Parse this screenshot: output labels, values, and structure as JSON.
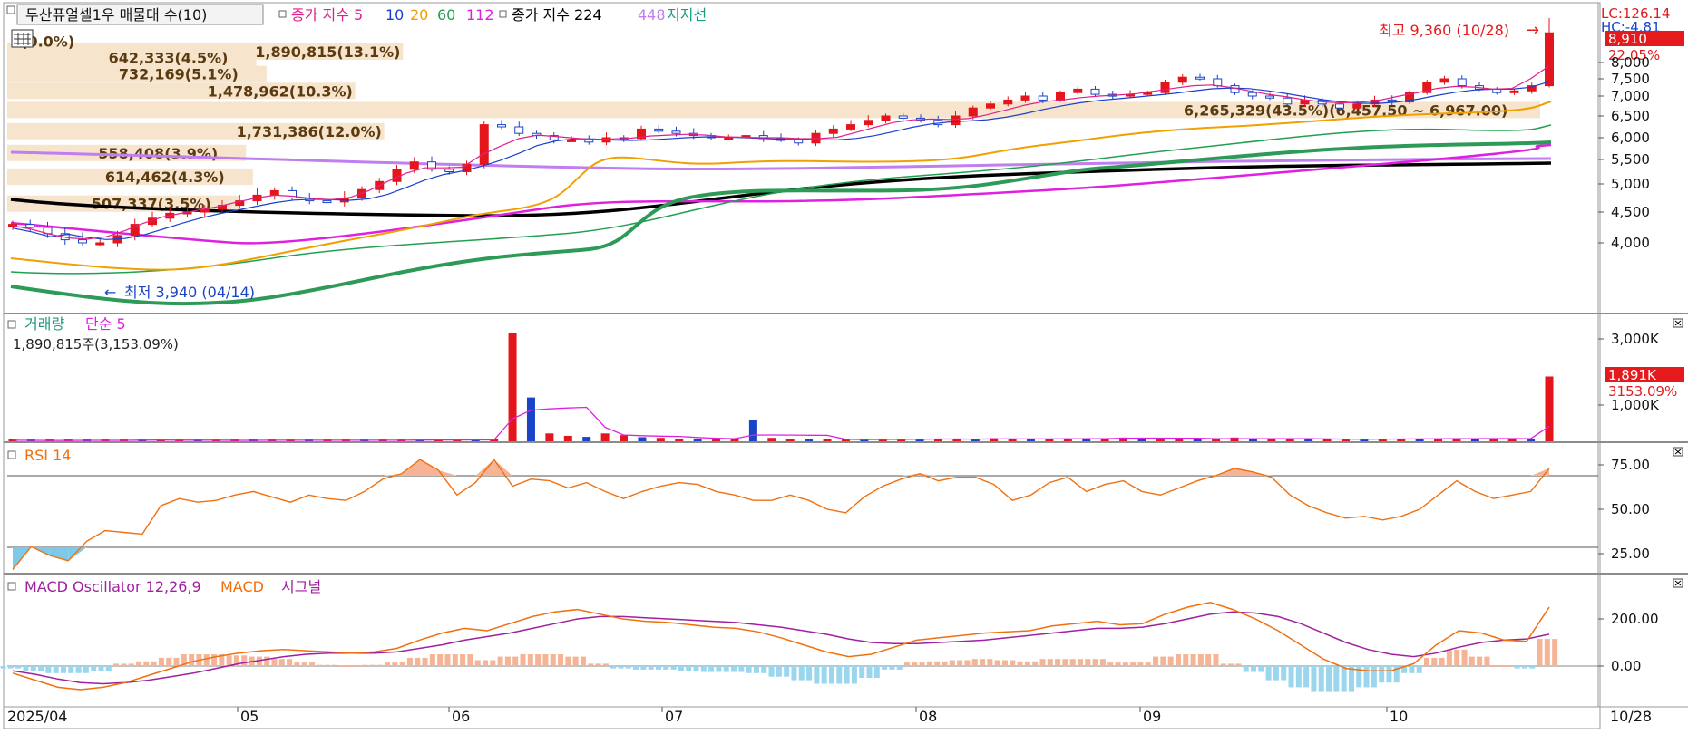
{
  "window": {
    "title": "두산퓨얼셀1우 매물대 수(10)"
  },
  "legends": {
    "price": [
      {
        "text": "종가 지수 5",
        "color": "#e0208a"
      },
      {
        "text": "10",
        "color": "#1a3fd0"
      },
      {
        "text": "20",
        "color": "#f0a000"
      },
      {
        "text": "60",
        "color": "#21a050"
      },
      {
        "text": "112",
        "color": "#e020e0"
      },
      {
        "text": "종가 지수 224",
        "color": "#000000"
      },
      {
        "text": "448",
        "color": "#c07ef0"
      },
      {
        "text": "지지선",
        "color": "#1a9a80"
      }
    ],
    "volume": [
      {
        "text": "거래량",
        "color": "#1a9a80"
      },
      {
        "text": "단순 5",
        "color": "#e020e0"
      }
    ],
    "rsi": [
      {
        "text": "RSI 14",
        "color": "#f07010"
      }
    ],
    "macd": [
      {
        "text": "MACD Oscillator 12,26,9",
        "color": "#a020a0"
      },
      {
        "text": "MACD",
        "color": "#f07010"
      },
      {
        "text": "시그널",
        "color": "#a020a0"
      }
    ]
  },
  "volume_profile": [
    {
      "label": "1,890,815(13.1%)",
      "pct": 13.1,
      "price": 9150
    },
    {
      "label": "0(0.0%)",
      "pct": 0.0,
      "price": 8650
    },
    {
      "label": "642,333(4.5%)",
      "pct": 4.5,
      "price": 8150
    },
    {
      "label": "732,169(5.1%)",
      "pct": 5.1,
      "price": 7650
    },
    {
      "label": "1,478,962(10.3%)",
      "pct": 10.3,
      "price": 7150
    },
    {
      "label": "6,265,329(43.5%)(6,457.50 ~ 6,967.00)",
      "pct": 43.5,
      "price": 6650
    },
    {
      "label": "1,731,386(12.0%)",
      "pct": 12.0,
      "price": 6150
    },
    {
      "label": "558,408(3.9%)",
      "pct": 3.9,
      "price": 5650
    },
    {
      "label": "614,462(4.3%)",
      "pct": 4.3,
      "price": 5150
    },
    {
      "label": "507,337(3.5%)",
      "pct": 3.5,
      "price": 4650
    }
  ],
  "annotations": {
    "high": "최고 9,360 (10/28)",
    "high_arrow": "→",
    "low": "최저 3,940 (04/14)",
    "low_arrow": "←",
    "volume_info": "1,890,815주(3,153.09%)"
  },
  "right_axis": {
    "lc": "LC:126.14",
    "hc": "HC:-4.81",
    "price_ticks": [
      "8,000",
      "7,500",
      "7,000",
      "6,500",
      "6,000",
      "5,500",
      "5,000",
      "4,500",
      "4,000"
    ],
    "volume_ticks": [
      "3,000K",
      "1,000K"
    ],
    "rsi_ticks": [
      "75.00",
      "50.00",
      "25.00"
    ],
    "macd_ticks": [
      "200.00",
      "0.00"
    ]
  },
  "current": {
    "price": "8,910",
    "change": "22.05%",
    "volume": "1,891K",
    "volume_pct": "3153.09%"
  },
  "x_axis": [
    "2025/04",
    "05",
    "06",
    "07",
    "08",
    "09",
    "10"
  ],
  "x_right_label": "10/28",
  "colors": {
    "up": "#e4151b",
    "down": "#1a44c8",
    "profile": "#f6e4cc",
    "rsi": "#f07010",
    "macd": "#f07010",
    "signal": "#a020a0",
    "osc_up": "#f5b496",
    "osc_down": "#9ad6ee"
  },
  "chart_data": [
    {
      "type": "candlestick",
      "title": "두산퓨얼셀1우",
      "x_range": [
        "2025/04",
        "10/28"
      ],
      "ylim": [
        3800,
        9400
      ],
      "series": [
        {
          "name": "종가",
          "values": [
            4300,
            4250,
            4150,
            4050,
            4000,
            4000,
            4120,
            4300,
            4400,
            4480,
            4500,
            4550,
            4620,
            4700,
            4800,
            4880,
            4750,
            4700,
            4680,
            4750,
            4900,
            5050,
            5300,
            5450,
            5300,
            5250,
            5400,
            6300,
            6250,
            6100,
            6050,
            5950,
            5950,
            5900,
            6000,
            5980,
            6200,
            6150,
            6100,
            6050,
            6000,
            6000,
            6050,
            5980,
            5950,
            5880,
            6100,
            6200,
            6300,
            6400,
            6500,
            6450,
            6400,
            6300,
            6500,
            6700,
            6800,
            6900,
            7000,
            6900,
            7100,
            7200,
            7050,
            7000,
            7050,
            7100,
            7400,
            7550,
            7500,
            7300,
            7100,
            7000,
            6950,
            6800,
            6900,
            6800,
            6700,
            6800,
            6900,
            6850,
            7100,
            7400,
            7500,
            7300,
            7200,
            7100,
            7150,
            7300,
            8910
          ]
        },
        {
          "name": "5",
          "values": [
            4280,
            4220,
            4140,
            4080,
            4060,
            4100,
            4200,
            4320,
            4420,
            4480,
            4540,
            4600,
            4680,
            4750,
            4800,
            4780,
            4740,
            4720,
            4760,
            4880,
            5050,
            5220,
            5330,
            5330,
            5340,
            5600,
            5800,
            5980,
            6060,
            6030,
            5990,
            5960,
            5970,
            5990,
            6040,
            6060,
            6080,
            6060,
            6020,
            6010,
            6000,
            6000,
            5980,
            5980,
            6010,
            6120,
            6240,
            6350,
            6410,
            6430,
            6420,
            6440,
            6530,
            6650,
            6770,
            6860,
            6900,
            6960,
            7000,
            7030,
            7070,
            7150,
            7230,
            7300,
            7320,
            7250,
            7150,
            7050,
            6980,
            6900,
            6850,
            6830,
            6850,
            6900,
            7000,
            7100,
            7220,
            7280,
            7260,
            7200,
            7220,
            7500,
            7900
          ]
        }
      ],
      "volume_profile_pct": [
        13.1,
        0.0,
        4.5,
        5.1,
        10.3,
        43.5,
        12.0,
        3.9,
        4.3,
        3.5
      ],
      "high": {
        "value": 9360,
        "date": "10/28"
      },
      "low": {
        "value": 3940,
        "date": "04/14"
      }
    },
    {
      "type": "bar",
      "title": "거래량",
      "ylabel": "",
      "values_k": [
        30,
        25,
        20,
        20,
        40,
        25,
        30,
        50,
        25,
        25,
        25,
        30,
        25,
        30,
        30,
        35,
        25,
        30,
        25,
        30,
        30,
        35,
        55,
        40,
        30,
        35,
        40,
        3153,
        1280,
        230,
        160,
        130,
        230,
        180,
        120,
        100,
        80,
        80,
        70,
        60,
        620,
        100,
        60,
        50,
        40,
        40,
        60,
        80,
        70,
        60,
        60,
        60,
        70,
        90,
        60,
        60,
        70,
        80,
        90,
        80,
        110,
        100,
        80,
        70,
        70,
        60,
        110,
        80,
        70,
        70,
        60,
        60,
        60,
        60,
        80,
        70,
        70,
        80,
        90,
        80,
        80,
        70,
        70,
        1891
      ],
      "ylim": [
        0,
        3300
      ]
    },
    {
      "type": "line",
      "title": "RSI 14",
      "ylim": [
        15,
        85
      ],
      "values": [
        16,
        29,
        24,
        21,
        32,
        38,
        37,
        36,
        52,
        56,
        54,
        55,
        58,
        60,
        57,
        54,
        58,
        56,
        55,
        60,
        67,
        70,
        78,
        72,
        58,
        65,
        78,
        63,
        67,
        66,
        62,
        65,
        60,
        56,
        60,
        63,
        65,
        64,
        60,
        58,
        55,
        55,
        58,
        55,
        50,
        48,
        57,
        63,
        67,
        70,
        66,
        68,
        68,
        64,
        55,
        58,
        65,
        68,
        60,
        64,
        66,
        60,
        58,
        62,
        66,
        69,
        73,
        71,
        68,
        58,
        52,
        48,
        45,
        46,
        44,
        46,
        50,
        58,
        66,
        60,
        56,
        58,
        60,
        73
      ]
    },
    {
      "type": "line",
      "title": "MACD Oscillator 12,26,9",
      "ylim": [
        -150,
        330
      ],
      "series": [
        {
          "name": "MACD",
          "values": [
            -30,
            -60,
            -90,
            -100,
            -90,
            -70,
            -40,
            -10,
            20,
            40,
            55,
            65,
            70,
            65,
            60,
            55,
            60,
            75,
            110,
            140,
            160,
            150,
            180,
            210,
            230,
            240,
            220,
            200,
            190,
            185,
            175,
            165,
            160,
            145,
            120,
            90,
            60,
            40,
            50,
            80,
            110,
            120,
            130,
            140,
            145,
            150,
            170,
            180,
            190,
            175,
            180,
            220,
            250,
            270,
            240,
            200,
            150,
            90,
            30,
            -10,
            -20,
            -20,
            10,
            90,
            150,
            140,
            110,
            105,
            250
          ]
        },
        {
          "name": "시그널",
          "values": [
            -20,
            -35,
            -55,
            -70,
            -75,
            -70,
            -60,
            -45,
            -30,
            -10,
            10,
            25,
            40,
            50,
            55,
            55,
            55,
            60,
            75,
            90,
            110,
            125,
            140,
            160,
            180,
            200,
            210,
            210,
            205,
            200,
            195,
            190,
            185,
            175,
            165,
            150,
            135,
            115,
            100,
            95,
            95,
            100,
            105,
            110,
            120,
            130,
            140,
            150,
            160,
            160,
            165,
            180,
            200,
            220,
            230,
            225,
            210,
            180,
            140,
            100,
            70,
            50,
            40,
            55,
            80,
            100,
            110,
            115,
            135
          ]
        },
        {
          "name": "Oscillator",
          "values": [
            -10,
            -20,
            -30,
            -30,
            -20,
            10,
            20,
            35,
            50,
            50,
            45,
            40,
            30,
            15,
            5,
            0,
            5,
            15,
            35,
            50,
            50,
            25,
            40,
            50,
            50,
            40,
            10,
            -10,
            -15,
            -15,
            -20,
            -25,
            -25,
            -30,
            -45,
            -60,
            -75,
            -75,
            -50,
            -15,
            15,
            20,
            25,
            30,
            25,
            20,
            30,
            30,
            30,
            15,
            15,
            40,
            50,
            50,
            10,
            -25,
            -60,
            -90,
            -110,
            -110,
            -90,
            -70,
            -30,
            35,
            70,
            40,
            0,
            -10,
            115
          ]
        }
      ]
    }
  ]
}
